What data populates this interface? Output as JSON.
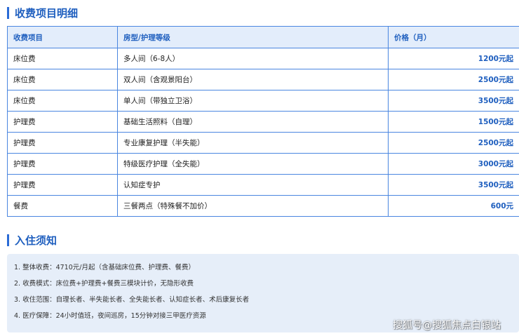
{
  "fees_section": {
    "title": "收费项目明细"
  },
  "fee_table": {
    "headers": [
      "收费项目",
      "房型/护理等级",
      "价格（月）"
    ],
    "rows": [
      {
        "item": "床位费",
        "level": "多人间（6-8人）",
        "price": "1200元起"
      },
      {
        "item": "床位费",
        "level": "双人间（含观景阳台）",
        "price": "2500元起"
      },
      {
        "item": "床位费",
        "level": "单人间（带独立卫浴）",
        "price": "3500元起"
      },
      {
        "item": "护理费",
        "level": "基础生活照料（自理）",
        "price": "1500元起"
      },
      {
        "item": "护理费",
        "level": "专业康复护理（半失能）",
        "price": "2500元起"
      },
      {
        "item": "护理费",
        "level": "特级医疗护理（全失能）",
        "price": "3000元起"
      },
      {
        "item": "护理费",
        "level": "认知症专护",
        "price": "3500元起"
      },
      {
        "item": "餐费",
        "level": "三餐两点（特殊餐不加价）",
        "price": "600元"
      }
    ]
  },
  "notice_section": {
    "title": "入住须知",
    "lines": [
      "1. 整体收费：4710元/月起（含基础床位费、护理费、餐费）",
      "2. 收费模式：床位费+护理费+餐费三模块计价，无隐形收费",
      "3. 收住范围：自理长者、半失能长者、全失能长者、认知症长者、术后康复长者",
      "4. 医疗保障：24小时值班，夜间巡房，15分钟对接三甲医疗资源"
    ]
  },
  "watermark": "搜狐号@搜狐焦点白银站",
  "colors": {
    "accent": "#1f5fbf",
    "header_bg": "#e3edfb",
    "border": "#4a86e0",
    "notice_bg": "#e6eef9"
  }
}
